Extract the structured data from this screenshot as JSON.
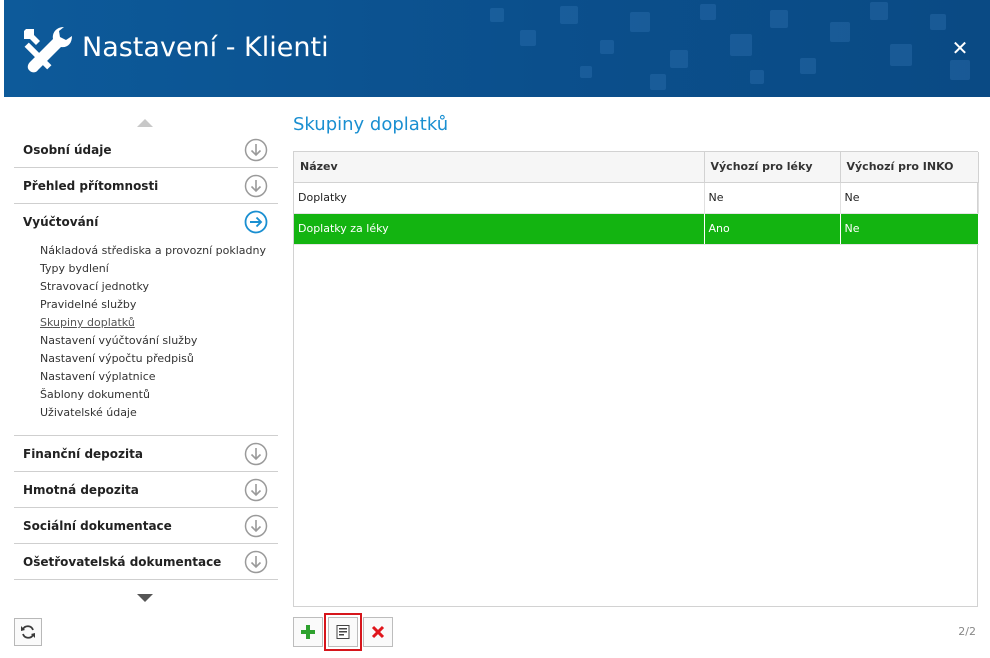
{
  "window": {
    "title": "Nastavení - Klienti",
    "close_icon": "close-icon",
    "colors": {
      "titlebar": "#0b4f8c",
      "accent": "#1a8fd1",
      "selected_row": "#13b411",
      "highlight": "#d6151b"
    }
  },
  "sidebar": {
    "sections": [
      {
        "label": "Osobní údaje",
        "icon": "arrow-down-circle-icon",
        "expanded": false
      },
      {
        "label": "Přehled přítomnosti",
        "icon": "arrow-down-circle-icon",
        "expanded": false
      },
      {
        "label": "Vyúčtování",
        "icon": "arrow-right-circle-icon",
        "expanded": true
      }
    ],
    "subitems": [
      {
        "label": "Nákladová střediska a provozní pokladny"
      },
      {
        "label": "Typy bydlení"
      },
      {
        "label": "Stravovací jednotky"
      },
      {
        "label": "Pravidelné služby"
      },
      {
        "label": "Skupiny doplatků",
        "active": true
      },
      {
        "label": "Nastavení vyúčtování služby"
      },
      {
        "label": "Nastavení výpočtu předpisů"
      },
      {
        "label": "Nastavení výplatnice"
      },
      {
        "label": "Šablony dokumentů"
      },
      {
        "label": "Uživatelské údaje"
      }
    ],
    "sections_after": [
      {
        "label": "Finanční depozita",
        "icon": "arrow-down-circle-icon"
      },
      {
        "label": "Hmotná depozita",
        "icon": "arrow-down-circle-icon"
      },
      {
        "label": "Sociální dokumentace",
        "icon": "arrow-down-circle-icon"
      },
      {
        "label": "Ošetřovatelská dokumentace",
        "icon": "arrow-down-circle-icon"
      }
    ]
  },
  "main": {
    "title": "Skupiny doplatků",
    "table": {
      "columns": [
        "Název",
        "Výchozí pro léky",
        "Výchozí pro INKO"
      ],
      "rows": [
        {
          "cells": [
            "Doplatky",
            "Ne",
            "Ne"
          ],
          "selected": false
        },
        {
          "cells": [
            "Doplatky za léky",
            "Ano",
            "Ne"
          ],
          "selected": true
        }
      ]
    },
    "toolbar": {
      "add_icon": "plus-icon",
      "edit_icon": "edit-document-icon",
      "delete_icon": "delete-x-icon"
    },
    "pager": "2/2"
  }
}
